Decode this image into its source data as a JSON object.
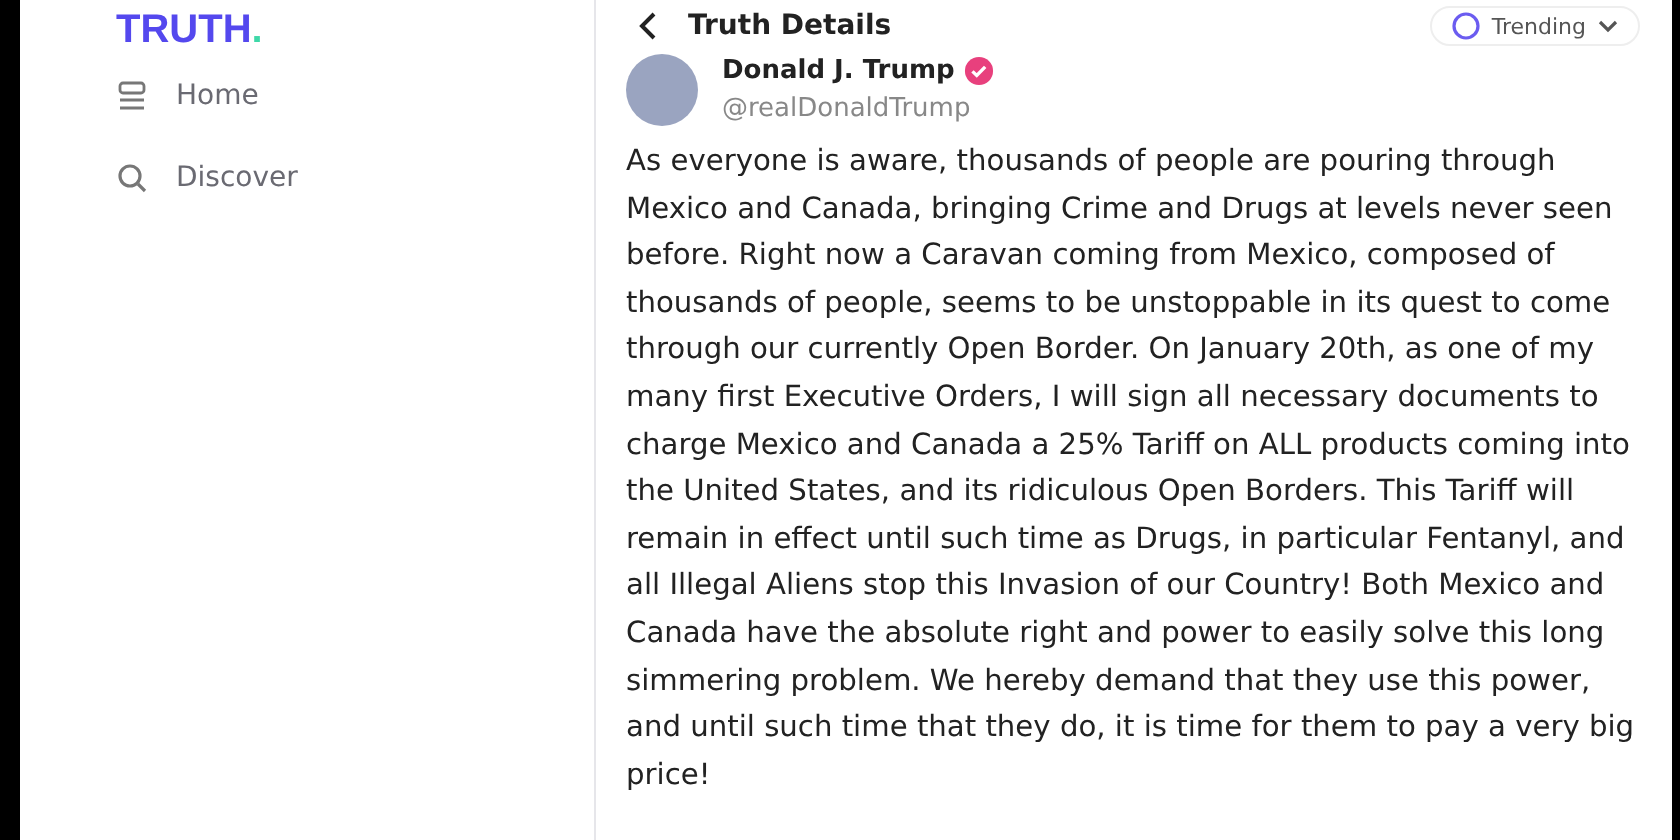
{
  "logo": {
    "text": "TRUTH",
    "mark": "."
  },
  "sidebar": {
    "items": [
      {
        "label": "Home",
        "selected": false
      },
      {
        "label": "Discover",
        "selected": false
      }
    ]
  },
  "header": {
    "title": "Truth Details",
    "filter": "Trending"
  },
  "post": {
    "author": "Donald J. Trump",
    "verified": true,
    "handle": "@realDonaldTrump",
    "text": "As everyone is aware, thousands of people are pouring through Mexico and Canada, bringing Crime and Drugs at levels never seen before. Right now a Caravan coming from Mexico, composed of thousands of people, seems to be unstoppable in its quest to come through our currently Open Border. On January 20th, as one of my many first Executive Orders, I will sign all necessary documents to charge Mexico and Canada a 25% Tariff on ALL products coming into the United States, and its ridiculous Open Borders. This Tariff will remain in effect until such time as Drugs, in particular Fentanyl, and all Illegal Aliens stop this Invasion of our Country! Both Mexico and Canada have the absolute right and power to easily solve this long simmering problem. We hereby demand that they use this power, and until such time that they do, it is time for them to pay a very big price!"
  }
}
